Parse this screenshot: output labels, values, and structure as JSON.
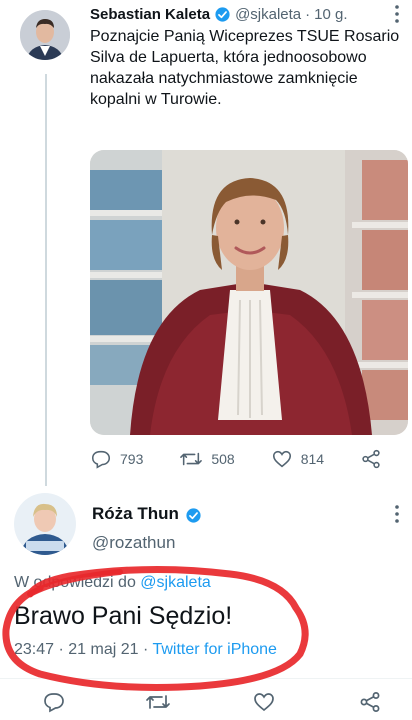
{
  "tweet": {
    "author_name": "Sebastian Kaleta",
    "author_handle": "@sjkaleta",
    "time_ago": "10 g.",
    "text": "Poznajcie Panią Wiceprezes TSUE Rosario Silva de Lapuerta, która jednoosobowo nakazała natychmiastowe zamknięcie kopalni w Turowie.",
    "stats": {
      "replies": "793",
      "retweets": "508",
      "likes": "814"
    }
  },
  "reply": {
    "author_name": "Róża Thun",
    "author_handle": "@rozathun",
    "replying_prefix": "W odpowiedzi do ",
    "replying_to": "@sjkaleta",
    "text": "Brawo Pani Sędzio!",
    "timestamp": "23:47 · 21 maj 21 · ",
    "source": "Twitter for iPhone"
  },
  "colors": {
    "accent": "#1d9bf0",
    "secondary_text": "#536471",
    "annotation": "#e8282b"
  },
  "icons": [
    "verified-icon",
    "more-icon",
    "reply-icon",
    "retweet-icon",
    "like-icon",
    "share-icon"
  ]
}
